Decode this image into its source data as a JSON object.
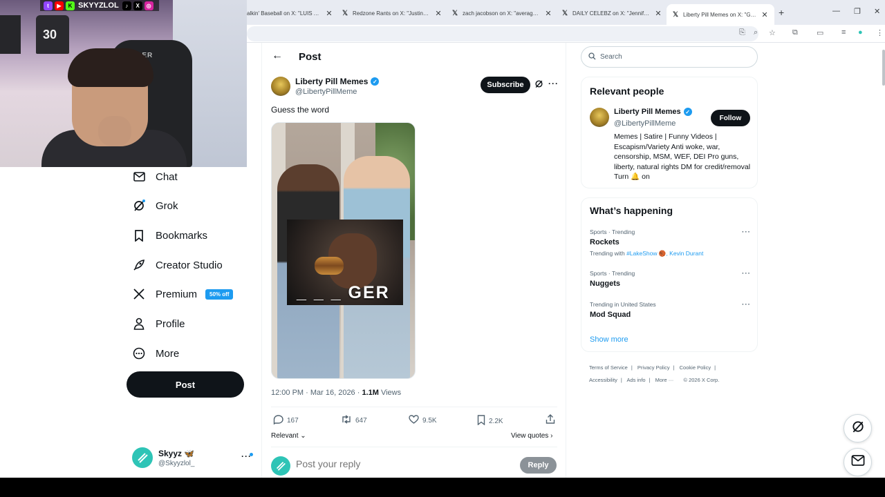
{
  "browser": {
    "tabs": [
      {
        "title": "alkin' Baseball on X: \"LUIS ARRA",
        "active": false
      },
      {
        "title": "Redzone Rants on X: \"Justin Fie",
        "active": false
      },
      {
        "title": "zach jacobson on X: \"average g",
        "active": false
      },
      {
        "title": "DAILY CELEBZ on X: \"Jennifer Lo",
        "active": false
      },
      {
        "title": "Liberty Pill Memes on X: \"Gues",
        "active": true
      }
    ]
  },
  "webcam": {
    "channel": "SKYYZLOL",
    "jersey_number": "30",
    "chair_brand": "PACER"
  },
  "nav": {
    "items": [
      {
        "label": "Chat",
        "icon": "mail-icon"
      },
      {
        "label": "Grok",
        "icon": "grok-icon"
      },
      {
        "label": "Bookmarks",
        "icon": "bookmark-icon"
      },
      {
        "label": "Creator Studio",
        "icon": "rocket-icon"
      },
      {
        "label": "Premium",
        "icon": "x-logo-icon",
        "badge": "50% off"
      },
      {
        "label": "Profile",
        "icon": "person-icon"
      },
      {
        "label": "More",
        "icon": "more-circle-icon"
      }
    ],
    "post_button": "Post",
    "account": {
      "name": "Skyyz 🦋",
      "handle": "@Skyyzlol_"
    }
  },
  "post": {
    "header_title": "Post",
    "author_name": "Liberty Pill Memes",
    "author_handle": "@LibertyPillMeme",
    "subscribe_label": "Subscribe",
    "text": "Guess the word",
    "media_overlay_text": "_ _ _ GER",
    "meta_time": "12:00 PM · Mar 16, 2026 · ",
    "meta_views": "1.1M",
    "meta_views_label": " Views",
    "replies": "167",
    "reposts": "647",
    "likes": "9.5K",
    "bookmarks": "2.2K",
    "sort_label": "Relevant",
    "view_quotes": "View quotes",
    "reply_placeholder": "Post your reply",
    "reply_button": "Reply"
  },
  "sidebar": {
    "search_placeholder": "Search",
    "relevant_title": "Relevant people",
    "relevant_person": {
      "name": "Liberty Pill Memes",
      "handle": "@LibertyPillMeme",
      "follow_label": "Follow",
      "bio": "Memes | Satire | Funny Videos | Escapism/Variety Anti woke, war, censorship, MSM, WEF, DEI Pro guns, liberty, natural rights DM for credit/removal Turn 🔔 on"
    },
    "happening_title": "What’s happening",
    "trends": [
      {
        "category": "Sports · Trending",
        "name": "Rockets",
        "with_prefix": "Trending with ",
        "with_links": "#LakeShow 🏀, Kevin Durant"
      },
      {
        "category": "Sports · Trending",
        "name": "Nuggets"
      },
      {
        "category": "Trending in United States",
        "name": "Mod Squad"
      }
    ],
    "show_more": "Show more",
    "footer": {
      "terms": "Terms of Service",
      "privacy": "Privacy Policy",
      "cookie": "Cookie Policy",
      "accessibility": "Accessibility",
      "ads": "Ads info",
      "more": "More ···",
      "copyright": "© 2026 X Corp."
    }
  }
}
